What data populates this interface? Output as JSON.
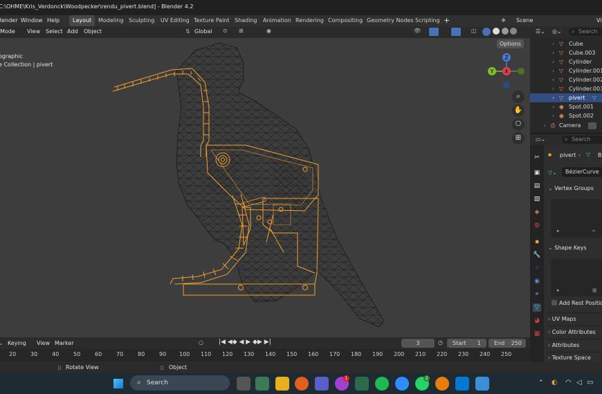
{
  "window": {
    "title": "C:\\OHME\\Kris_Verdonck\\Woodpecker\\rendu_pivert.blend] - Blender 4.2"
  },
  "menu": {
    "items": [
      "Render",
      "Window",
      "Help"
    ]
  },
  "workspaces": [
    "Layout",
    "Modeling",
    "Sculpting",
    "UV Editing",
    "Texture Paint",
    "Shading",
    "Animation",
    "Rendering",
    "Compositing",
    "Geometry Nodes",
    "Scripting"
  ],
  "scene": {
    "label": "Scene",
    "view_layer": "Vi"
  },
  "viewport": {
    "mode": "Mode",
    "menus": [
      "View",
      "Select",
      "Add",
      "Object"
    ],
    "transform": "Global",
    "options": "Options",
    "overlay_line1": "ographic",
    "overlay_line2": "e Collection | pivert",
    "gizmo": {
      "z": "Z",
      "x": "X",
      "y": "Y"
    }
  },
  "outliner": {
    "search_placeholder": "Search",
    "items": [
      {
        "name": "Cube",
        "selected": false
      },
      {
        "name": "Cube.003",
        "selected": false
      },
      {
        "name": "Cylinder",
        "selected": false
      },
      {
        "name": "Cylinder.001",
        "selected": false
      },
      {
        "name": "Cylinder.002",
        "selected": false
      },
      {
        "name": "Cylinder.003",
        "selected": false
      },
      {
        "name": "pivert",
        "selected": true
      },
      {
        "name": "Spot.001",
        "selected": false
      },
      {
        "name": "Spot.002",
        "selected": false
      },
      {
        "name": "Camera",
        "selected": false
      }
    ]
  },
  "properties": {
    "search_placeholder": "Search",
    "object_name": "pivert",
    "data_label": "B",
    "curve_name": "BézierCurve",
    "panels": [
      "Vertex Groups",
      "Shape Keys",
      "UV Maps",
      "Color Attributes",
      "Attributes",
      "Texture Space"
    ],
    "add_rest_position": "Add Rest Position"
  },
  "timeline": {
    "menus": [
      "Keying",
      "View",
      "Marker"
    ],
    "current_frame": "3",
    "start_label": "Start",
    "start": "1",
    "end_label": "End",
    "end": "250",
    "ticks": [
      "20",
      "30",
      "40",
      "50",
      "60",
      "70",
      "80",
      "90",
      "100",
      "110",
      "120",
      "130",
      "140",
      "150",
      "160",
      "170",
      "180",
      "190",
      "200",
      "210",
      "220",
      "230",
      "240",
      "250"
    ]
  },
  "statusbar": {
    "hint1": "Rotate View",
    "hint2": "Object"
  },
  "taskbar": {
    "search": "Search",
    "badge1": "1",
    "badge2": "2"
  },
  "colors": {
    "selected_orange": "#f0a030",
    "outliner_select": "#334d80",
    "accent_blue": "#4772b3"
  }
}
